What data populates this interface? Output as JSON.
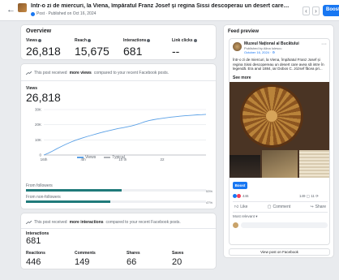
{
  "header": {
    "back_icon": "arrow-left-icon",
    "title": "Într-o zi de miercuri, la Viena, împăratul Franz Josef și regina Sissi descoperau un desert care avea să intre în legendă. Era ...",
    "subtitle": "Post · Published on Oct 16, 2024",
    "prev_label": "‹",
    "next_label": "›",
    "boost_label": "Boost"
  },
  "overview": {
    "title": "Overview",
    "metrics": [
      {
        "label": "Views",
        "value": "26,818"
      },
      {
        "label": "Reach",
        "value": "15,675"
      },
      {
        "label": "Interactions",
        "value": "681"
      },
      {
        "label": "Link clicks",
        "value": "--"
      }
    ]
  },
  "views": {
    "note_pre": "This post received",
    "note_bold": "more views",
    "note_post": "compared to your recent Facebook posts.",
    "label": "Views",
    "value": "26,818",
    "from_followers_label": "From followers",
    "from_followers_pct": "53%",
    "from_followers_frac": 0.53,
    "from_nonfollowers_label": "From non-followers",
    "from_nonfollowers_pct": "47%",
    "from_nonfollowers_frac": 0.47,
    "legend_views": "Views",
    "legend_typical": "Typical"
  },
  "chart_data": {
    "type": "line",
    "x": [
      "16th",
      "",
      "",
      "",
      "",
      "",
      "",
      "",
      "",
      "",
      "",
      "",
      "",
      "",
      "",
      "",
      "",
      "",
      "",
      "",
      "",
      "",
      "",
      "",
      "",
      "",
      "",
      "",
      "",
      "",
      "",
      "",
      "",
      "",
      "",
      "",
      "",
      ""
    ],
    "xticks": [
      {
        "i": 0,
        "label": "16th"
      },
      {
        "i": 9,
        "label": "4th"
      },
      {
        "i": 18,
        "label": "10 th"
      },
      {
        "i": 27,
        "label": "22"
      }
    ],
    "yticks": [
      0,
      10000,
      20000,
      30000
    ],
    "ytick_labels": [
      "0",
      "10K",
      "20K",
      "30K"
    ],
    "ylim": [
      0,
      30000
    ],
    "grid": true,
    "series": [
      {
        "name": "Views",
        "color": "#5aa0e6",
        "values": [
          0,
          1200,
          2600,
          4200,
          5600,
          7000,
          8300,
          9500,
          10500,
          11400,
          12300,
          13100,
          14000,
          14800,
          15500,
          16200,
          16900,
          17500,
          18000,
          18600,
          19200,
          20000,
          20900,
          21900,
          22700,
          23300,
          23800,
          24200,
          24600,
          25000,
          25300,
          25600,
          25900,
          26100,
          26300,
          26500,
          26650,
          26818
        ]
      },
      {
        "name": "Typical",
        "color": "#b0b3b8",
        "values": [
          0,
          0,
          0,
          0,
          0,
          0,
          0,
          0,
          0,
          0,
          0,
          0,
          0,
          0,
          0,
          0,
          0,
          0,
          0,
          0,
          0,
          0,
          0,
          0,
          0,
          0,
          0,
          0,
          0,
          0,
          0,
          0,
          0,
          0,
          0,
          0,
          0,
          0
        ]
      }
    ]
  },
  "interactions": {
    "note_pre": "This post received",
    "note_bold": "more interactions",
    "note_post": "compared to your recent Facebook posts.",
    "label": "Interactions",
    "value": "681",
    "sub": [
      {
        "label": "Reactions",
        "value": "446"
      },
      {
        "label": "Comments",
        "value": "149"
      },
      {
        "label": "Shares",
        "value": "66"
      },
      {
        "label": "Saves",
        "value": "20"
      }
    ]
  },
  "preview": {
    "title": "Feed preview",
    "page_name": "Muzeul Național al Bucătului",
    "published_by": "Published by Alina Iulescu",
    "date": "October 16, 2024 · ⚙",
    "text": "Într-o zi de miercuri, la Viena, împăratul Franz Josef și regina Sissi descopereau un desert care avea să intre în legendă. Era anul 1884, iar Dobos C. József făcea pri...",
    "see_more": "See more",
    "boost_label": "Boost",
    "reactions": "446",
    "counts": "149 ▢ 11 ⟳",
    "like_label": "Like",
    "comment_label": "Comment",
    "share_label": "Share",
    "most_relevant": "Most relevant ▾",
    "view_post": "View post on Facebook"
  }
}
